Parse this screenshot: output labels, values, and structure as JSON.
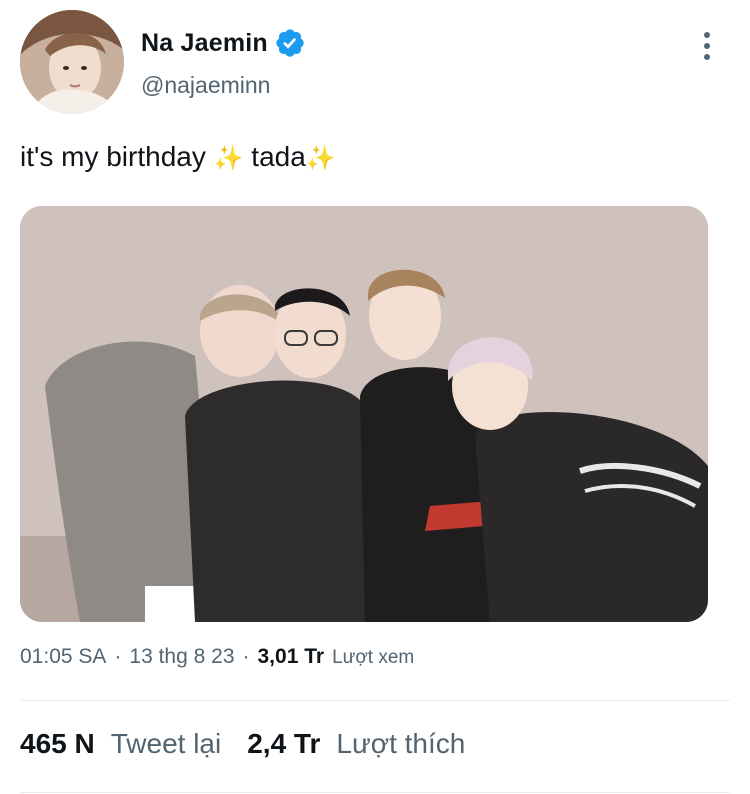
{
  "author": {
    "display_name": "Na Jaemin",
    "handle": "@najaeminn",
    "verified": true
  },
  "tweet": {
    "text_before": "it's my birthday ",
    "sparkle_1": "✨",
    "text_after": " tada",
    "sparkle_2": "✨"
  },
  "meta": {
    "time": "01:05 SA",
    "sep1": "·",
    "date": "13 thg 8 23",
    "sep2": "·",
    "views_count": "3,01 Tr",
    "views_label": "Lượt xem"
  },
  "stats": {
    "retweets_count": "465 N",
    "retweets_label": "Tweet lại",
    "likes_count": "2,4 Tr",
    "likes_label": "Lượt thích"
  },
  "icons": {
    "verified": "verified-badge-icon",
    "more": "more-options-icon"
  },
  "colors": {
    "verified": "#1d9bf0",
    "secondary_text": "#536471",
    "primary_text": "#0f1419"
  }
}
